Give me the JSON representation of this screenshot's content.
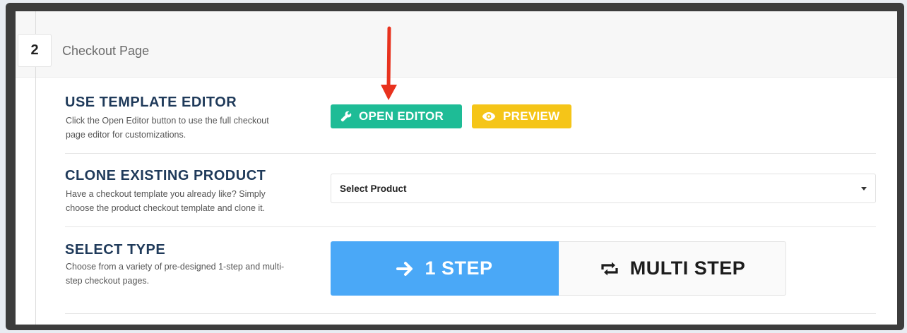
{
  "step": {
    "number": "2",
    "title": "Checkout Page"
  },
  "sections": {
    "template_editor": {
      "title": "USE TEMPLATE EDITOR",
      "description": "Click the Open Editor button to use the full checkout page editor for customizations.",
      "open_editor_label": "OPEN EDITOR",
      "preview_label": "PREVIEW"
    },
    "clone_product": {
      "title": "CLONE EXISTING PRODUCT",
      "description": "Have a checkout template you already like? Simply choose the product checkout template and clone it.",
      "select_value": "Select Product"
    },
    "select_type": {
      "title": "SELECT TYPE",
      "description": "Choose from a variety of pre-designed 1-step and multi-step checkout pages.",
      "one_step_label": "1 STEP",
      "multi_step_label": "MULTI STEP",
      "selected": "1 STEP"
    }
  },
  "colors": {
    "open_editor": "#1ebc96",
    "preview": "#f5c518",
    "one_step_active": "#4aa8f7",
    "title": "#1f3a5a",
    "annotation_arrow": "#e8321e"
  },
  "icons": {
    "open_editor": "wrench-icon",
    "preview": "eye-icon",
    "one_step": "arrow-right-icon",
    "multi_step": "repeat-icon",
    "annotation": "red-arrow-annotation"
  }
}
